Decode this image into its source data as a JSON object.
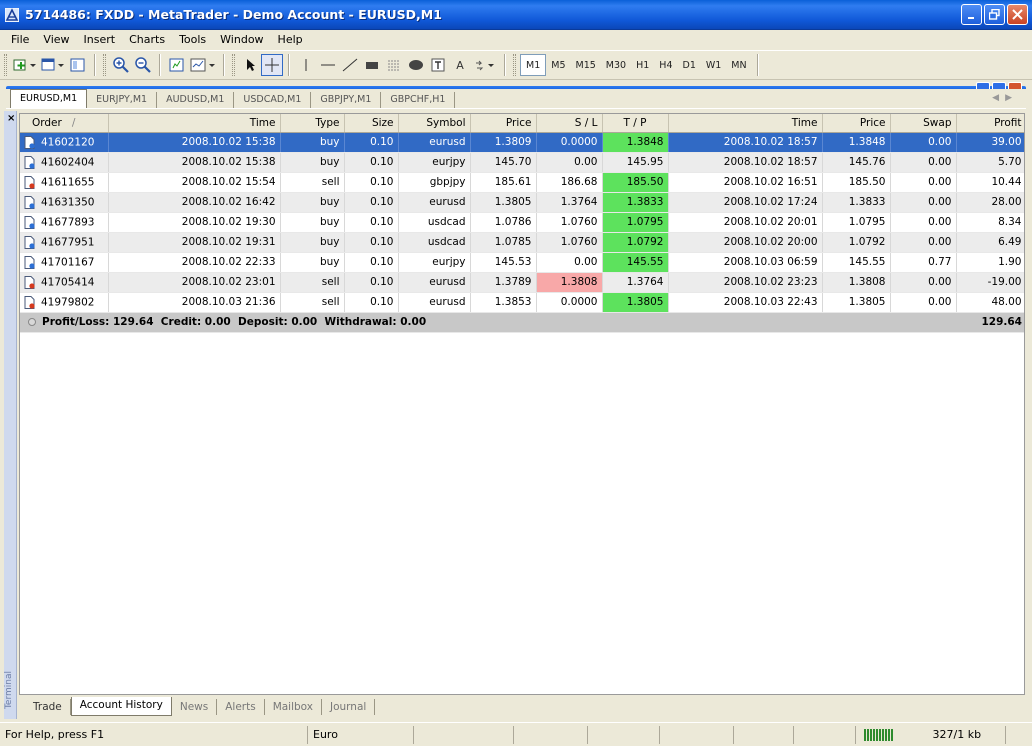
{
  "window": {
    "title": "5714486: FXDD - MetaTrader - Demo Account - EURUSD,M1"
  },
  "menu": [
    "File",
    "View",
    "Insert",
    "Charts",
    "Tools",
    "Window",
    "Help"
  ],
  "toolbar": {
    "timeframes": [
      "M1",
      "M5",
      "M15",
      "M30",
      "H1",
      "H4",
      "D1",
      "W1",
      "MN"
    ],
    "active_timeframe": "M1",
    "text_tool_label": "A"
  },
  "chart_tabs": [
    "EURUSD,M1",
    "EURJPY,M1",
    "AUDUSD,M1",
    "USDCAD,M1",
    "GBPJPY,M1",
    "GBPCHF,H1"
  ],
  "active_chart_tab": "EURUSD,M1",
  "terminal": {
    "side_label": "Terminal",
    "columns": [
      "Order",
      "Time",
      "Type",
      "Size",
      "Symbol",
      "Price",
      "S / L",
      "T / P",
      "Time",
      "Price",
      "Swap",
      "Profit"
    ],
    "sort_indicator": "/",
    "rows": [
      {
        "order": "41602120",
        "open_time": "2008.10.02 15:38",
        "type": "buy",
        "size": "0.10",
        "symbol": "eurusd",
        "price": "1.3809",
        "sl": "0.0000",
        "tp": "1.3848",
        "close_time": "2008.10.02 18:57",
        "close_price": "1.3848",
        "swap": "0.00",
        "profit": "39.00",
        "icon": "buy-order-icon",
        "hit": "tp"
      },
      {
        "order": "41602404",
        "open_time": "2008.10.02 15:38",
        "type": "buy",
        "size": "0.10",
        "symbol": "eurjpy",
        "price": "145.70",
        "sl": "0.00",
        "tp": "145.95",
        "close_time": "2008.10.02 18:57",
        "close_price": "145.76",
        "swap": "0.00",
        "profit": "5.70",
        "icon": "buy-order-icon",
        "hit": ""
      },
      {
        "order": "41611655",
        "open_time": "2008.10.02 15:54",
        "type": "sell",
        "size": "0.10",
        "symbol": "gbpjpy",
        "price": "185.61",
        "sl": "186.68",
        "tp": "185.50",
        "close_time": "2008.10.02 16:51",
        "close_price": "185.50",
        "swap": "0.00",
        "profit": "10.44",
        "icon": "sell-order-icon",
        "hit": "tp"
      },
      {
        "order": "41631350",
        "open_time": "2008.10.02 16:42",
        "type": "buy",
        "size": "0.10",
        "symbol": "eurusd",
        "price": "1.3805",
        "sl": "1.3764",
        "tp": "1.3833",
        "close_time": "2008.10.02 17:24",
        "close_price": "1.3833",
        "swap": "0.00",
        "profit": "28.00",
        "icon": "buy-order-icon",
        "hit": "tp"
      },
      {
        "order": "41677893",
        "open_time": "2008.10.02 19:30",
        "type": "buy",
        "size": "0.10",
        "symbol": "usdcad",
        "price": "1.0786",
        "sl": "1.0760",
        "tp": "1.0795",
        "close_time": "2008.10.02 20:01",
        "close_price": "1.0795",
        "swap": "0.00",
        "profit": "8.34",
        "icon": "buy-order-icon",
        "hit": "tp"
      },
      {
        "order": "41677951",
        "open_time": "2008.10.02 19:31",
        "type": "buy",
        "size": "0.10",
        "symbol": "usdcad",
        "price": "1.0785",
        "sl": "1.0760",
        "tp": "1.0792",
        "close_time": "2008.10.02 20:00",
        "close_price": "1.0792",
        "swap": "0.00",
        "profit": "6.49",
        "icon": "buy-order-icon",
        "hit": "tp"
      },
      {
        "order": "41701167",
        "open_time": "2008.10.02 22:33",
        "type": "buy",
        "size": "0.10",
        "symbol": "eurjpy",
        "price": "145.53",
        "sl": "0.00",
        "tp": "145.55",
        "close_time": "2008.10.03 06:59",
        "close_price": "145.55",
        "swap": "0.77",
        "profit": "1.90",
        "icon": "buy-order-icon",
        "hit": "tp"
      },
      {
        "order": "41705414",
        "open_time": "2008.10.02 23:01",
        "type": "sell",
        "size": "0.10",
        "symbol": "eurusd",
        "price": "1.3789",
        "sl": "1.3808",
        "tp": "1.3764",
        "close_time": "2008.10.02 23:23",
        "close_price": "1.3808",
        "swap": "0.00",
        "profit": "-19.00",
        "icon": "sell-order-icon",
        "hit": "sl"
      },
      {
        "order": "41979802",
        "open_time": "2008.10.03 21:36",
        "type": "sell",
        "size": "0.10",
        "symbol": "eurusd",
        "price": "1.3853",
        "sl": "0.0000",
        "tp": "1.3805",
        "close_time": "2008.10.03 22:43",
        "close_price": "1.3805",
        "swap": "0.00",
        "profit": "48.00",
        "icon": "sell-order-icon",
        "hit": "tp"
      }
    ],
    "summary_text": "Profit/Loss: 129.64  Credit: 0.00  Deposit: 0.00  Withdrawal: 0.00",
    "summary_total": "129.64",
    "tabs": [
      "Trade",
      "Account History",
      "News",
      "Alerts",
      "Mailbox",
      "Journal"
    ],
    "active_tab": "Account History"
  },
  "status": {
    "help": "For Help, press F1",
    "profile": "Euro",
    "traffic": "327/1 kb"
  },
  "colors": {
    "selected_row": "#316ac5",
    "tp_hit": "#5de25d",
    "sl_hit": "#f8a8a8"
  }
}
